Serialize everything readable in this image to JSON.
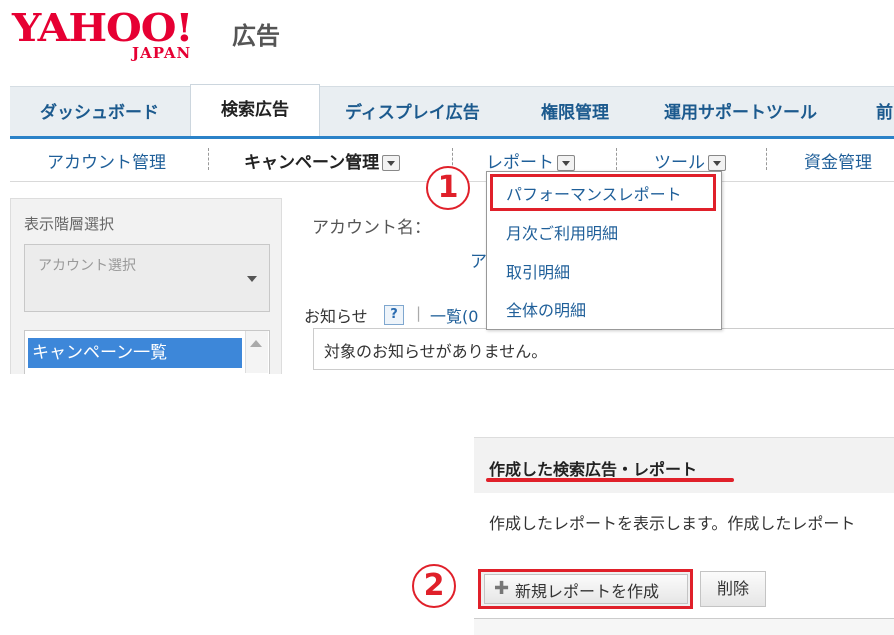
{
  "logo": {
    "main": "YAHOO!",
    "sub": "JAPAN",
    "suffix": "広告"
  },
  "main_tabs": [
    {
      "label": "ダッシュボード"
    },
    {
      "label": "検索広告",
      "active": true
    },
    {
      "label": "ディスプレイ広告"
    },
    {
      "label": "権限管理"
    },
    {
      "label": "運用サポートツール"
    },
    {
      "label": "前"
    }
  ],
  "sub_nav": {
    "account": "アカウント管理",
    "campaign": "キャンペーン管理",
    "report": "レポート",
    "tools": "ツール",
    "funds": "資金管理"
  },
  "dropdown_items": [
    "パフォーマンスレポート",
    "月次ご利用明細",
    "取引明細",
    "全体の明細"
  ],
  "left_panel": {
    "title": "表示階層選択",
    "account_select_placeholder": "アカウント選択",
    "campaign_item": "キャンペーン一覧"
  },
  "content": {
    "account_name_label": "アカウント名：",
    "account_link": "ア",
    "notice_label": "お知らせ",
    "help_glyph": "?",
    "separator": "|",
    "list_link": "一覧(0",
    "notice_text": "対象のお知らせがありません。"
  },
  "report_section": {
    "title": "作成した検索広告・レポート",
    "description": "作成したレポートを表示します。作成したレポート",
    "new_report_button": "新規レポートを作成",
    "delete_button": "削除"
  },
  "annotations": {
    "step1": "1",
    "step2": "2"
  },
  "colors": {
    "accent_red": "#e0202a",
    "link_blue": "#1f5f99",
    "tab_blue": "#2b82c8",
    "selected_blue": "#3d87d9",
    "brand_red": "#e60033"
  }
}
